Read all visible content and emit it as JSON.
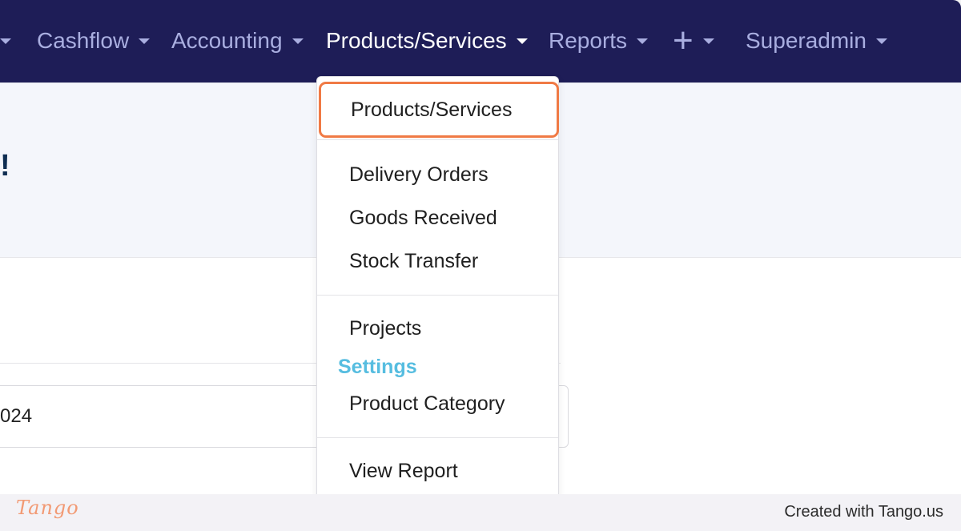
{
  "navbar": {
    "items": [
      {
        "label": "Cashflow"
      },
      {
        "label": "Accounting"
      },
      {
        "label": "Products/Services"
      },
      {
        "label": "Reports"
      },
      {
        "label": "+"
      },
      {
        "label": "Superadmin"
      }
    ]
  },
  "page": {
    "heading_fragment": "!",
    "date_value": "024"
  },
  "dropdown": {
    "items": [
      {
        "label": "Products/Services"
      },
      {
        "label": "Delivery Orders"
      },
      {
        "label": "Goods Received"
      },
      {
        "label": "Stock Transfer"
      },
      {
        "label": "Projects"
      },
      {
        "label": "Product Category"
      },
      {
        "label": "View Report"
      }
    ],
    "settings_header": "Settings"
  },
  "footer": {
    "logo_text": "Tango",
    "created_with": "Created with Tango.us"
  },
  "colors": {
    "navbar_bg": "#1e1d57",
    "highlight_border": "#f07a45",
    "settings_header": "#56bde0",
    "tango_brand": "#f29a74"
  }
}
